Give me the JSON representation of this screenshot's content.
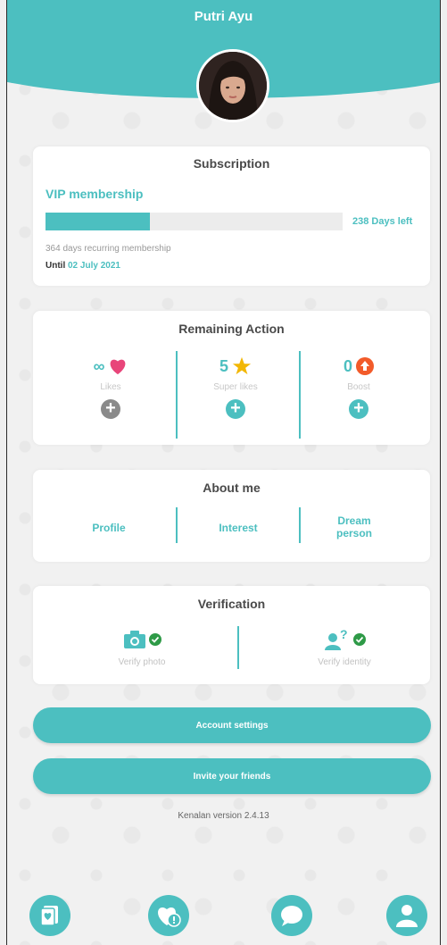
{
  "header": {
    "user_name": "Putri Ayu"
  },
  "subscription": {
    "title": "Subscription",
    "plan": "VIP membership",
    "progress": 0.35,
    "days_left": "238 Days left",
    "recurring": "364 days recurring membership",
    "until_prefix": "Until",
    "until_date": "02 July 2021"
  },
  "remaining_action": {
    "title": "Remaining Action",
    "items": [
      {
        "value": "∞",
        "label": "Likes",
        "icon": "heart-icon"
      },
      {
        "value": "5",
        "label": "Super likes",
        "icon": "star-icon"
      },
      {
        "value": "0",
        "label": "Boost",
        "icon": "boost-icon"
      }
    ]
  },
  "about_me": {
    "title": "About me",
    "links": [
      "Profile",
      "Interest",
      "Dream person"
    ]
  },
  "verification": {
    "title": "Verification",
    "items": [
      {
        "label": "Verify photo",
        "icon": "camera-icon"
      },
      {
        "label": "Verify identity",
        "icon": "identity-icon"
      }
    ]
  },
  "buttons": {
    "account_settings": "Account settings",
    "invite_friends": "Invite your friends"
  },
  "version": "Kenalan version 2.4.13",
  "bottom_nav": [
    "cards-icon",
    "liked-me-icon",
    "chat-icon",
    "profile-icon"
  ],
  "colors": {
    "accent": "#4cbfc0",
    "heart": "#e8457a",
    "star": "#f2b705",
    "boost": "#f25b2a",
    "check": "#2e9a47"
  }
}
